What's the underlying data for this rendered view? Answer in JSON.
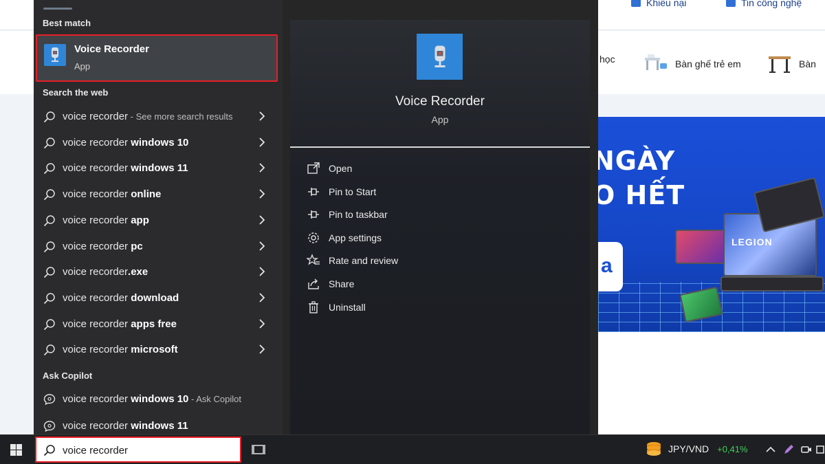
{
  "background_page": {
    "top_links": [
      "Khiếu nại",
      "Tin công nghệ"
    ],
    "categories": [
      "học",
      "Bàn ghế trẻ em",
      "Bàn"
    ],
    "banner_lines": [
      "NGÀY",
      "O HẾT"
    ],
    "banner_brand": "LEGION",
    "banner_fragment": "a"
  },
  "start_menu": {
    "best_match_title": "Best match",
    "best_match": {
      "name": "Voice Recorder",
      "type": "App",
      "icon": "voice-recorder-icon"
    },
    "web_title": "Search the web",
    "web_results": [
      {
        "prefix": "voice recorder",
        "bold": "",
        "suffix": " - See more search results"
      },
      {
        "prefix": "voice recorder ",
        "bold": "windows 10",
        "suffix": ""
      },
      {
        "prefix": "voice recorder ",
        "bold": "windows 11",
        "suffix": ""
      },
      {
        "prefix": "voice recorder ",
        "bold": "online",
        "suffix": ""
      },
      {
        "prefix": "voice recorder ",
        "bold": "app",
        "suffix": ""
      },
      {
        "prefix": "voice recorder ",
        "bold": "pc",
        "suffix": ""
      },
      {
        "prefix": "voice recorder",
        "bold": ".exe",
        "suffix": ""
      },
      {
        "prefix": "voice recorder ",
        "bold": "download",
        "suffix": ""
      },
      {
        "prefix": "voice recorder ",
        "bold": "apps free",
        "suffix": ""
      },
      {
        "prefix": "voice recorder ",
        "bold": "microsoft",
        "suffix": ""
      }
    ],
    "copilot_title": "Ask Copilot",
    "copilot_results": [
      {
        "prefix": "voice recorder ",
        "bold": "windows 10",
        "suffix": " - Ask Copilot"
      },
      {
        "prefix": "voice recorder ",
        "bold": "windows 11",
        "suffix": ""
      }
    ]
  },
  "detail_pane": {
    "name": "Voice Recorder",
    "type": "App",
    "actions": [
      {
        "label": "Open",
        "icon": "open-icon"
      },
      {
        "label": "Pin to Start",
        "icon": "pin-icon"
      },
      {
        "label": "Pin to taskbar",
        "icon": "pin-icon"
      },
      {
        "label": "App settings",
        "icon": "gear-icon"
      },
      {
        "label": "Rate and review",
        "icon": "star-icon"
      },
      {
        "label": "Share",
        "icon": "share-icon"
      },
      {
        "label": "Uninstall",
        "icon": "trash-icon"
      }
    ]
  },
  "taskbar": {
    "search_value": "voice recorder",
    "currency_pair": "JPY/VND",
    "currency_change": "+0,41%",
    "colors": {
      "accent": "#2f86d8",
      "highlight_border": "#e81e26",
      "positive": "#3fd15a"
    }
  }
}
